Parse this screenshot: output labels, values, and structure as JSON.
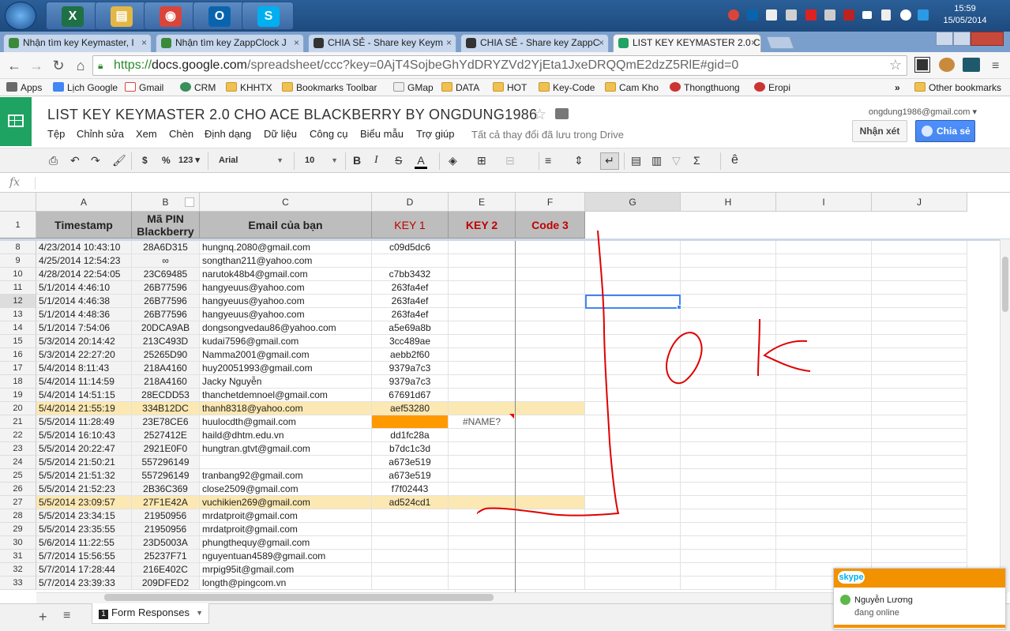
{
  "taskbar": {
    "apps": [
      {
        "name": "excel",
        "glyph": "X",
        "color": "#1e7145"
      },
      {
        "name": "explorer",
        "glyph": "▤",
        "color": "#e3b745"
      },
      {
        "name": "chrome",
        "glyph": "◉",
        "color": "#d9453b"
      },
      {
        "name": "outlook",
        "glyph": "O",
        "color": "#0a64ad"
      },
      {
        "name": "skype",
        "glyph": "S",
        "color": "#00aff0"
      }
    ],
    "time": "15:59",
    "date": "15/05/2014"
  },
  "browser": {
    "tabs": [
      {
        "label": "Nhận tìm key Keymaster, I",
        "active": false
      },
      {
        "label": "Nhận tìm key ZappClock J",
        "active": false
      },
      {
        "label": "CHIA SẺ - Share key Keym",
        "active": false
      },
      {
        "label": "CHIA SẺ - Share key ZappC",
        "active": false
      },
      {
        "label": "LIST KEY KEYMASTER 2.0 C",
        "active": true
      }
    ],
    "close_glyph": "×",
    "url_scheme": "https://",
    "url_host": "docs.google.com",
    "url_path": "/spreadsheet/ccc?key=0AjT4SojbeGhYdDRYZVd2YjEta1JxeDRQQmE2dzZ5RlE#gid=0",
    "bookmarks": [
      {
        "label": "Apps",
        "icon": "apps"
      },
      {
        "label": "Lịch Google",
        "icon": "calendar"
      },
      {
        "label": "Gmail",
        "icon": "gmail"
      },
      {
        "label": "CRM",
        "icon": "crm"
      },
      {
        "label": "KHHTX",
        "icon": "folder"
      },
      {
        "label": "Bookmarks Toolbar",
        "icon": "folder"
      },
      {
        "label": "GMap",
        "icon": "gmap"
      },
      {
        "label": "DATA",
        "icon": "folder"
      },
      {
        "label": "HOT",
        "icon": "folder"
      },
      {
        "label": "Key-Code",
        "icon": "folder"
      },
      {
        "label": "Cam Kho",
        "icon": "folder"
      },
      {
        "label": "Thongthuong",
        "icon": "site"
      },
      {
        "label": "Eropi",
        "icon": "site"
      }
    ],
    "more_bookmarks": "»",
    "other_bookmarks": "Other bookmarks"
  },
  "doc": {
    "title": "LIST KEY KEYMASTER 2.0 CHO ACE BLACKBERRY BY ONGDUNG1986",
    "menus": [
      "Tệp",
      "Chỉnh sửa",
      "Xem",
      "Chèn",
      "Định dạng",
      "Dữ liệu",
      "Công cụ",
      "Biểu mẫu",
      "Trợ giúp"
    ],
    "saved_status": "Tất cả thay đổi đã lưu trong Drive",
    "account": "ongdung1986@gmail.com ▾",
    "comment_label": "Nhận xét",
    "share_label": "Chia sẻ"
  },
  "toolbar": {
    "currency": "$",
    "percent": "%",
    "number_format": "123 ▾",
    "font": "Arial",
    "font_size": "10",
    "bold": "B",
    "italic": "I",
    "strike": "S",
    "text_color": "A",
    "formula_label": "fx",
    "sigma": "Σ",
    "input_tools": "ê"
  },
  "grid": {
    "columns": [
      "A",
      "B",
      "C",
      "D",
      "E",
      "F",
      "G",
      "H",
      "I",
      "J"
    ],
    "headers": {
      "timestamp": "Timestamp",
      "pin": "Mã PIN Blackberry",
      "email": "Email của bạn",
      "key1": "KEY 1",
      "key2": "KEY 2",
      "code3": "Code 3"
    },
    "header_row_number": "1",
    "rows": [
      {
        "n": "8",
        "ts": "4/23/2014 10:43:10",
        "pin": "28A6D315",
        "email": "hungnq.2080@gmail.com",
        "key1": "c09d5dc6",
        "key2": ""
      },
      {
        "n": "9",
        "ts": "4/25/2014 12:54:23",
        "pin": "∞",
        "email": "songthan211@yahoo.com",
        "key1": "",
        "key2": ""
      },
      {
        "n": "10",
        "ts": "4/28/2014 22:54:05",
        "pin": "23C69485",
        "email": "narutok48b4@gmail.com",
        "key1": "c7bb3432",
        "key2": ""
      },
      {
        "n": "11",
        "ts": "5/1/2014 4:46:10",
        "pin": "26B77596",
        "email": "hangyeuus@yahoo.com",
        "key1": "263fa4ef",
        "key2": ""
      },
      {
        "n": "12",
        "ts": "5/1/2014 4:46:38",
        "pin": "26B77596",
        "email": "hangyeuus@yahoo.com",
        "key1": "263fa4ef",
        "key2": ""
      },
      {
        "n": "13",
        "ts": "5/1/2014 4:48:36",
        "pin": "26B77596",
        "email": "hangyeuus@yahoo.com",
        "key1": "263fa4ef",
        "key2": ""
      },
      {
        "n": "14",
        "ts": "5/1/2014 7:54:06",
        "pin": "20DCA9AB",
        "email": "dongsongvedau86@yahoo.com",
        "key1": "a5e69a8b",
        "key2": ""
      },
      {
        "n": "15",
        "ts": "5/3/2014 20:14:42",
        "pin": "213C493D",
        "email": "kudai7596@gmail.com",
        "key1": "3cc489ae",
        "key2": ""
      },
      {
        "n": "16",
        "ts": "5/3/2014 22:27:20",
        "pin": "25265D90",
        "email": "Namma2001@gmail.com",
        "key1": "aebb2f60",
        "key2": ""
      },
      {
        "n": "17",
        "ts": "5/4/2014 8:11:43",
        "pin": "218A4160",
        "email": "huy20051993@gmail.com",
        "key1": "9379a7c3",
        "key2": ""
      },
      {
        "n": "18",
        "ts": "5/4/2014 11:14:59",
        "pin": "218A4160",
        "email": "Jacky Nguyễn",
        "key1": "9379a7c3",
        "key2": ""
      },
      {
        "n": "19",
        "ts": "5/4/2014 14:51:15",
        "pin": "28ECDD53",
        "email": "thanchetdemnoel@gmail.com",
        "key1": "67691d67",
        "key2": ""
      },
      {
        "n": "20",
        "ts": "5/4/2014 21:55:19",
        "pin": "334B12DC",
        "email": "thanh8318@yahoo.com",
        "key1": "aef53280",
        "key2": ""
      },
      {
        "n": "21",
        "ts": "5/5/2014 11:28:49",
        "pin": "23E78CE6",
        "email": "huulocdth@gmail.com",
        "key1": "",
        "key2": "#NAME?"
      },
      {
        "n": "22",
        "ts": "5/5/2014 16:10:43",
        "pin": "2527412E",
        "email": "haild@dhtm.edu.vn",
        "key1": "dd1fc28a",
        "key2": ""
      },
      {
        "n": "23",
        "ts": "5/5/2014 20:22:47",
        "pin": "2921E0F0",
        "email": "hungtran.gtvt@gmail.com",
        "key1": "b7dc1c3d",
        "key2": ""
      },
      {
        "n": "24",
        "ts": "5/5/2014 21:50:21",
        "pin": "557296149",
        "email": "",
        "key1": "a673e519",
        "key2": ""
      },
      {
        "n": "25",
        "ts": "5/5/2014 21:51:32",
        "pin": "557296149",
        "email": "tranbang92@gmail.com",
        "key1": "a673e519",
        "key2": ""
      },
      {
        "n": "26",
        "ts": "5/5/2014 21:52:23",
        "pin": "2B36C369",
        "email": "close2509@gmail.com",
        "key1": "f7f02443",
        "key2": ""
      },
      {
        "n": "27",
        "ts": "5/5/2014 23:09:57",
        "pin": "27F1E42A",
        "email": "vuchikien269@gmail.com",
        "key1": "ad524cd1",
        "key2": ""
      },
      {
        "n": "28",
        "ts": "5/5/2014 23:34:15",
        "pin": "21950956",
        "email": "mrdatproit@gmail.com",
        "key1": "",
        "key2": ""
      },
      {
        "n": "29",
        "ts": "5/5/2014 23:35:55",
        "pin": "21950956",
        "email": "mrdatproit@gmail.com",
        "key1": "",
        "key2": ""
      },
      {
        "n": "30",
        "ts": "5/6/2014 11:22:55",
        "pin": "23D5003A",
        "email": "phungthequy@gmail.com",
        "key1": "",
        "key2": ""
      },
      {
        "n": "31",
        "ts": "5/7/2014 15:56:55",
        "pin": "25237F71",
        "email": "nguyentuan4589@gmail.com",
        "key1": "",
        "key2": ""
      },
      {
        "n": "32",
        "ts": "5/7/2014 17:28:44",
        "pin": "216E402C",
        "email": "mrpig95it@gmail.com",
        "key1": "",
        "key2": ""
      },
      {
        "n": "33",
        "ts": "5/7/2014 23:39:33",
        "pin": "209DFED2",
        "email": "longth@pingcom.vn",
        "key1": "",
        "key2": ""
      }
    ]
  },
  "sheets": {
    "tab_number": "1",
    "tab_label": "Form Responses"
  },
  "skype_popup": {
    "logo": "skype",
    "contact_name": "Nguyễn Lương",
    "status": "đang online"
  },
  "colors": {
    "sheets_green": "#1ea362",
    "share_blue": "#4d90fe",
    "highlight_row": "#fce8b2",
    "orange_cell": "#ff9900",
    "header_gray": "#bdbdbd",
    "key_red": "#c00000",
    "annotation_red": "#e00000",
    "selection_blue": "#4285f4",
    "skype_orange": "#f39200"
  }
}
